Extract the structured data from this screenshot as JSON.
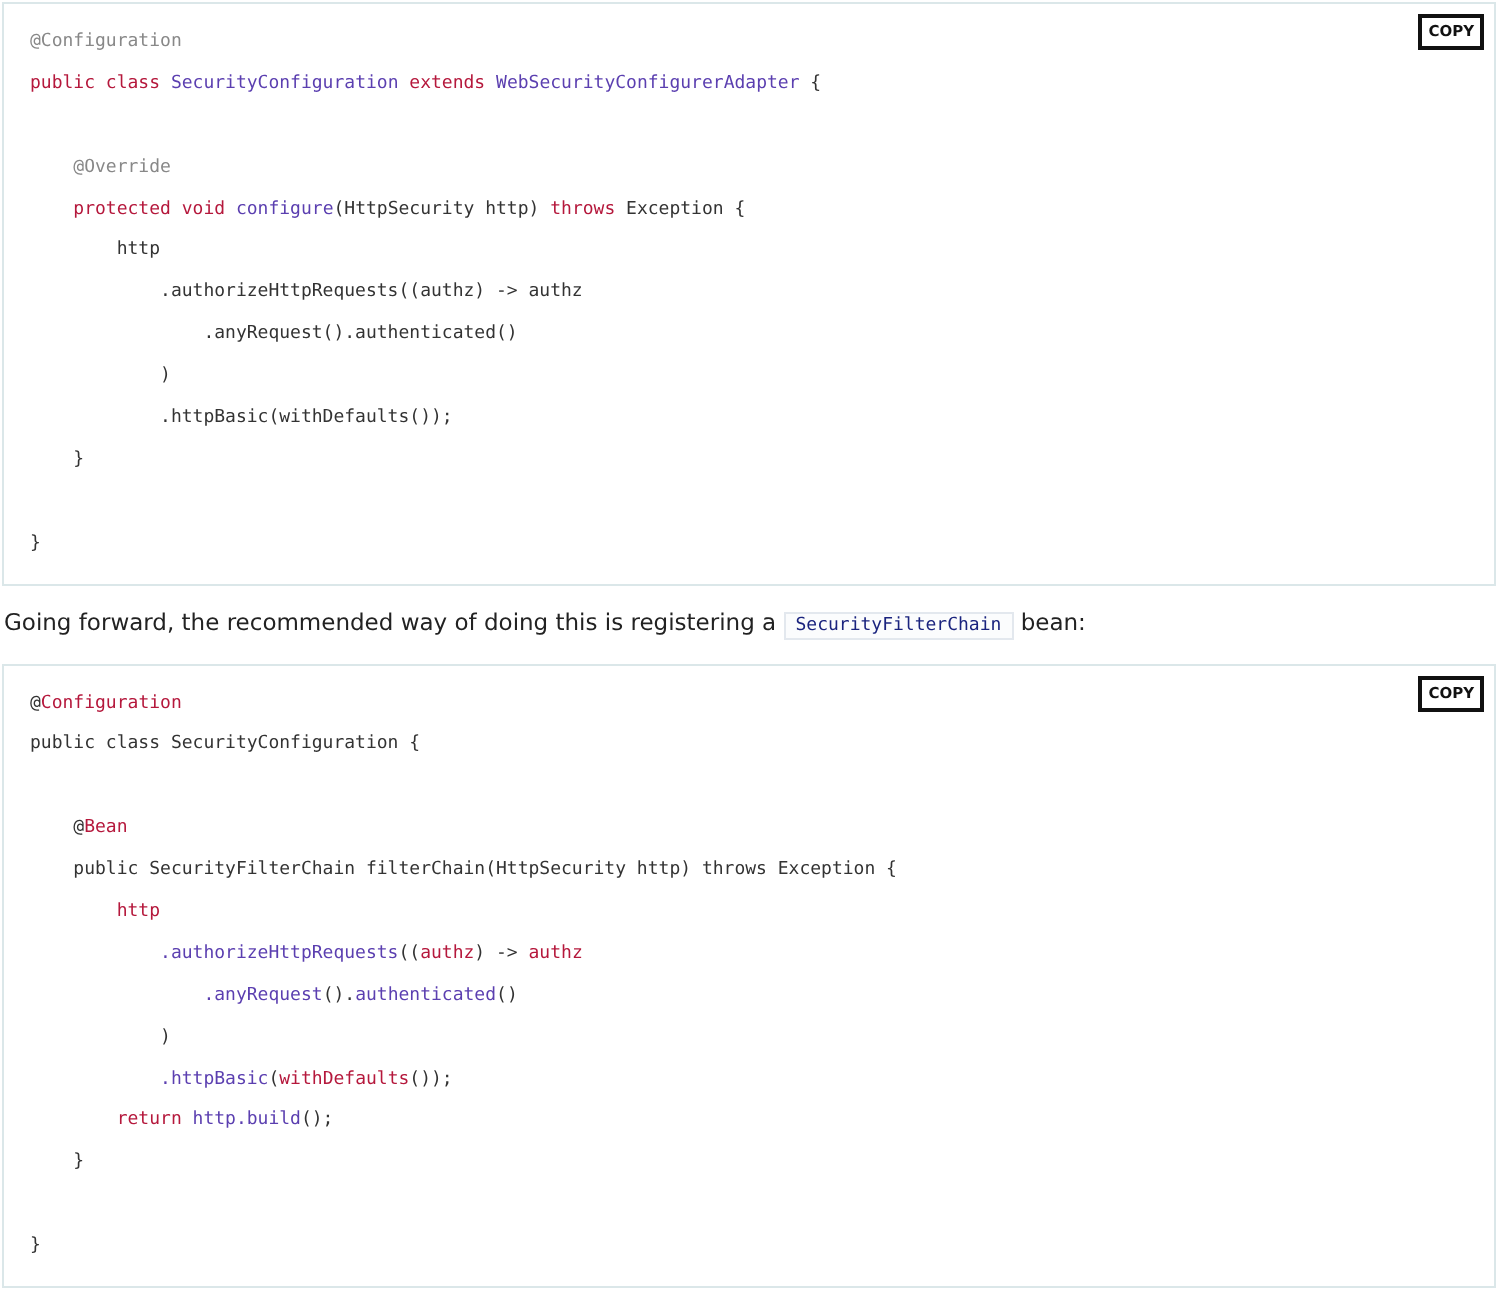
{
  "content": [
    {
      "kind": "code",
      "copy_button": "COPY",
      "lines": [
        {
          "kind": "code",
          "tokens": [
            {
              "t": "@Configuration",
              "kind": "note"
            }
          ]
        },
        {
          "kind": "code",
          "tokens": [
            {
              "t": "public class",
              "kind": "kw"
            },
            {
              "t": " SecurityConfiguration",
              "kind": "name"
            },
            {
              "t": " extends",
              "kind": "kw"
            },
            {
              "t": " WebSecurityConfigurerAdapter",
              "kind": "name"
            },
            {
              "t": " {",
              "kind": "plain"
            }
          ]
        },
        {
          "kind": "blank"
        },
        {
          "kind": "code",
          "tokens": [
            {
              "t": "    @Override",
              "kind": "note"
            }
          ]
        },
        {
          "kind": "code",
          "tokens": [
            {
              "t": "    protected void",
              "kind": "kw"
            },
            {
              "t": " configure",
              "kind": "name"
            },
            {
              "t": "(HttpSecurity http) ",
              "kind": "plain"
            },
            {
              "t": "throws",
              "kind": "kw"
            },
            {
              "t": " Exception {",
              "kind": "plain"
            }
          ]
        },
        {
          "kind": "code",
          "tokens": [
            {
              "t": "        http",
              "kind": "plain"
            }
          ]
        },
        {
          "kind": "code",
          "tokens": [
            {
              "t": "            .authorizeHttpRequests((authz) -> authz",
              "kind": "plain"
            }
          ]
        },
        {
          "kind": "code",
          "tokens": [
            {
              "t": "                .anyRequest().authenticated()",
              "kind": "plain"
            }
          ]
        },
        {
          "kind": "code",
          "tokens": [
            {
              "t": "            )",
              "kind": "plain"
            }
          ]
        },
        {
          "kind": "code",
          "tokens": [
            {
              "t": "            .httpBasic(withDefaults());",
              "kind": "plain"
            }
          ]
        },
        {
          "kind": "code",
          "tokens": [
            {
              "t": "    }",
              "kind": "plain"
            }
          ]
        },
        {
          "kind": "blank"
        },
        {
          "kind": "code",
          "tokens": [
            {
              "t": "}",
              "kind": "plain"
            }
          ]
        }
      ]
    },
    {
      "kind": "paragraph",
      "parts": [
        {
          "t": "Going forward, the recommended way of doing this is registering a ",
          "kind": "text"
        },
        {
          "t": "SecurityFilterChain",
          "kind": "code"
        },
        {
          "t": " bean:",
          "kind": "text"
        }
      ]
    },
    {
      "kind": "code",
      "copy_button": "COPY",
      "lines": [
        {
          "kind": "code",
          "tokens": [
            {
              "t": "@",
              "kind": "plain"
            },
            {
              "t": "Configuration",
              "kind": "kw"
            }
          ]
        },
        {
          "kind": "code",
          "tokens": [
            {
              "t": "public class SecurityConfiguration {",
              "kind": "plain"
            }
          ]
        },
        {
          "kind": "blank"
        },
        {
          "kind": "code",
          "tokens": [
            {
              "t": "    @",
              "kind": "plain"
            },
            {
              "t": "Bean",
              "kind": "kw"
            }
          ]
        },
        {
          "kind": "code",
          "tokens": [
            {
              "t": "    public SecurityFilterChain filterChain(HttpSecurity http) throws Exception {",
              "kind": "plain"
            }
          ]
        },
        {
          "kind": "code",
          "tokens": [
            {
              "t": "        http",
              "kind": "kw"
            }
          ]
        },
        {
          "kind": "code",
          "tokens": [
            {
              "t": "            .authorizeHttpRequests",
              "kind": "name"
            },
            {
              "t": "((",
              "kind": "plain"
            },
            {
              "t": "authz",
              "kind": "kw"
            },
            {
              "t": ") -> ",
              "kind": "plain"
            },
            {
              "t": "authz",
              "kind": "kw"
            }
          ]
        },
        {
          "kind": "code",
          "tokens": [
            {
              "t": "                .anyRequest",
              "kind": "name"
            },
            {
              "t": "().",
              "kind": "plain"
            },
            {
              "t": "authenticated",
              "kind": "name"
            },
            {
              "t": "()",
              "kind": "plain"
            }
          ]
        },
        {
          "kind": "code",
          "tokens": [
            {
              "t": "            )",
              "kind": "plain"
            }
          ]
        },
        {
          "kind": "code",
          "tokens": [
            {
              "t": "            .httpBasic",
              "kind": "name"
            },
            {
              "t": "(",
              "kind": "plain"
            },
            {
              "t": "withDefaults",
              "kind": "kw"
            },
            {
              "t": "());",
              "kind": "plain"
            }
          ]
        },
        {
          "kind": "code",
          "tokens": [
            {
              "t": "        return",
              "kind": "kw"
            },
            {
              "t": " http.build",
              "kind": "name"
            },
            {
              "t": "();",
              "kind": "plain"
            }
          ]
        },
        {
          "kind": "code",
          "tokens": [
            {
              "t": "    }",
              "kind": "plain"
            }
          ]
        },
        {
          "kind": "blank"
        },
        {
          "kind": "code",
          "tokens": [
            {
              "t": "}",
              "kind": "plain"
            }
          ]
        }
      ]
    }
  ]
}
